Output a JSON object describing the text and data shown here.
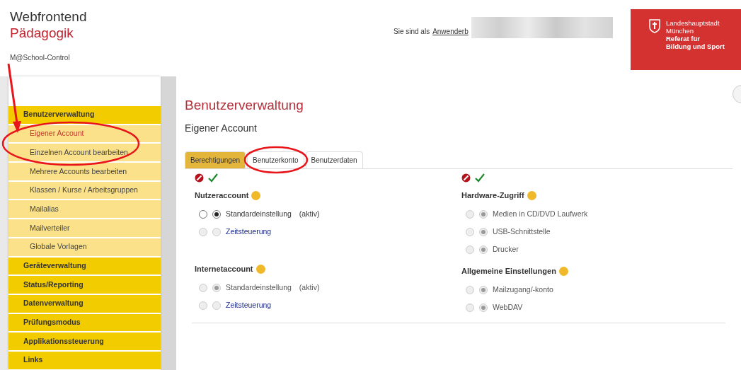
{
  "header": {
    "title": "Webfrontend",
    "subtitle": "Pädagogik",
    "product": "M@School-Control",
    "login_text": "Sie sind als",
    "login_link": "Anwenderb",
    "logo_lines": [
      {
        "text": "Landeshauptstadt",
        "bold": false
      },
      {
        "text": "München",
        "bold": false
      },
      {
        "text": "Referat für",
        "bold": true
      },
      {
        "text": "Bildung und Sport",
        "bold": true
      }
    ]
  },
  "sidebar": {
    "items": [
      {
        "label": "Benutzerverwaltung",
        "selected": false,
        "children": [
          {
            "label": "Eigener Account",
            "selected": true
          },
          {
            "label": "Einzelnen Account bearbeiten",
            "selected": false
          },
          {
            "label": "Mehrere Accounts bearbeiten",
            "selected": false
          },
          {
            "label": "Klassen / Kurse / Arbeitsgruppen",
            "selected": false
          },
          {
            "label": "Mailalias",
            "selected": false
          },
          {
            "label": "Mailverteiler",
            "selected": false
          },
          {
            "label": "Globale Vorlagen",
            "selected": false
          }
        ]
      },
      {
        "label": "Geräteverwaltung",
        "selected": false
      },
      {
        "label": "Status/Reporting",
        "selected": false
      },
      {
        "label": "Datenverwaltung",
        "selected": false
      },
      {
        "label": "Prüfungsmodus",
        "selected": false
      },
      {
        "label": "Applikationssteuerung",
        "selected": false
      },
      {
        "label": "Links",
        "selected": false
      }
    ]
  },
  "main": {
    "title": "Benutzerverwaltung",
    "subtitle": "Eigener Account",
    "tabs": [
      {
        "label": "Berechtigungen",
        "selected": true
      },
      {
        "label": "Benutzerkonto",
        "selected": false
      },
      {
        "label": "Benutzerdaten",
        "selected": false
      }
    ],
    "columns": [
      {
        "groups": [
          {
            "title": "Nutzeraccount",
            "options": [
              {
                "label": "Standardeinstellung",
                "note": "(aktiv)",
                "kind": "text",
                "denied": false,
                "allowed": true,
                "disabled": false
              },
              {
                "label": "Zeitsteuerung",
                "kind": "link",
                "denied": false,
                "allowed": false,
                "disabled": true
              }
            ]
          },
          {
            "title": "Internetaccount",
            "options": [
              {
                "label": "Standardeinstellung",
                "note": "(aktiv)",
                "kind": "text",
                "denied": false,
                "allowed": true,
                "disabled": true
              },
              {
                "label": "Zeitsteuerung",
                "kind": "link",
                "denied": false,
                "allowed": false,
                "disabled": true
              }
            ]
          }
        ]
      },
      {
        "groups": [
          {
            "title": "Hardware-Zugriff",
            "options": [
              {
                "label": "Medien in CD/DVD Laufwerk",
                "kind": "text",
                "denied": false,
                "allowed": true,
                "disabled": true
              },
              {
                "label": "USB-Schnittstelle",
                "kind": "text",
                "denied": false,
                "allowed": true,
                "disabled": true
              },
              {
                "label": "Drucker",
                "kind": "text",
                "denied": false,
                "allowed": true,
                "disabled": true
              }
            ]
          },
          {
            "title": "Allgemeine Einstellungen",
            "options": [
              {
                "label": "Mailzugang/-konto",
                "kind": "text",
                "denied": false,
                "allowed": true,
                "disabled": true
              },
              {
                "label": "WebDAV",
                "kind": "text",
                "denied": false,
                "allowed": true,
                "disabled": true
              }
            ]
          }
        ]
      }
    ]
  }
}
